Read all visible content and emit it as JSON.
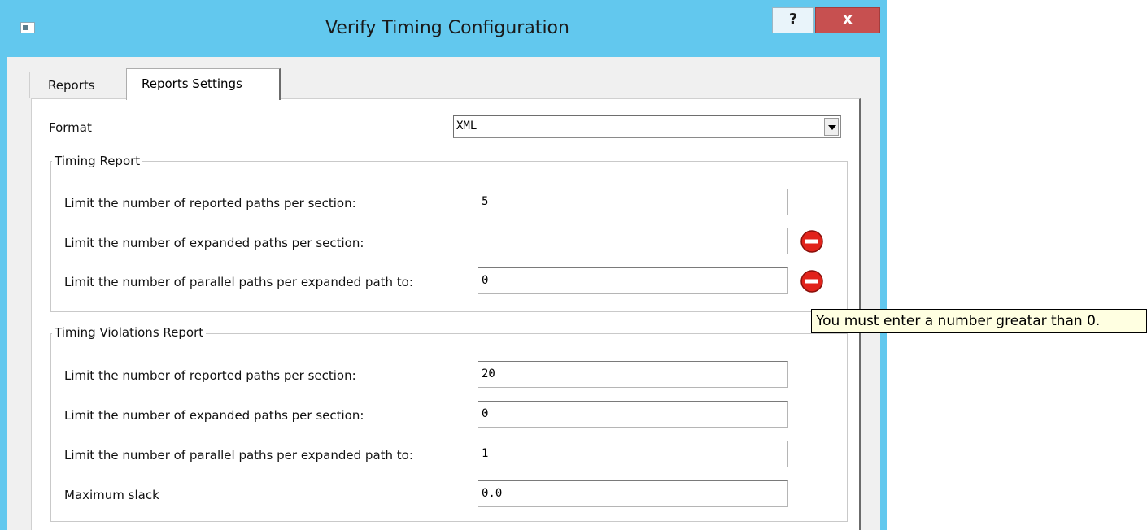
{
  "window": {
    "title": "Verify Timing Configuration",
    "help_label": "?",
    "close_label": "x"
  },
  "tabs": [
    {
      "label": "Reports",
      "active": false
    },
    {
      "label": "Reports Settings",
      "active": true
    }
  ],
  "format": {
    "label": "Format",
    "selected": "XML"
  },
  "timing_report": {
    "title": "Timing Report",
    "rows": [
      {
        "label": "Limit the number of reported paths per section:",
        "value": "5",
        "error": false
      },
      {
        "label": "Limit the number of expanded paths per section:",
        "value": "",
        "error": true
      },
      {
        "label": "Limit the number of parallel paths per expanded path to:",
        "value": "0",
        "error": true
      }
    ]
  },
  "violations_report": {
    "title": "Timing Violations Report",
    "rows": [
      {
        "label": "Limit the number of reported paths per section:",
        "value": "20"
      },
      {
        "label": "Limit the number of expanded paths per section:",
        "value": "0"
      },
      {
        "label": "Limit the number of parallel paths per expanded path to:",
        "value": "1"
      },
      {
        "label": "Maximum slack",
        "value": "0.0"
      }
    ]
  },
  "tooltip": {
    "text": "You must enter a number greatar than 0."
  },
  "colors": {
    "titlebar": "#62c8ee",
    "close_button": "#c75050",
    "error_icon": "#e1231b",
    "tooltip_bg": "#ffffe1"
  }
}
